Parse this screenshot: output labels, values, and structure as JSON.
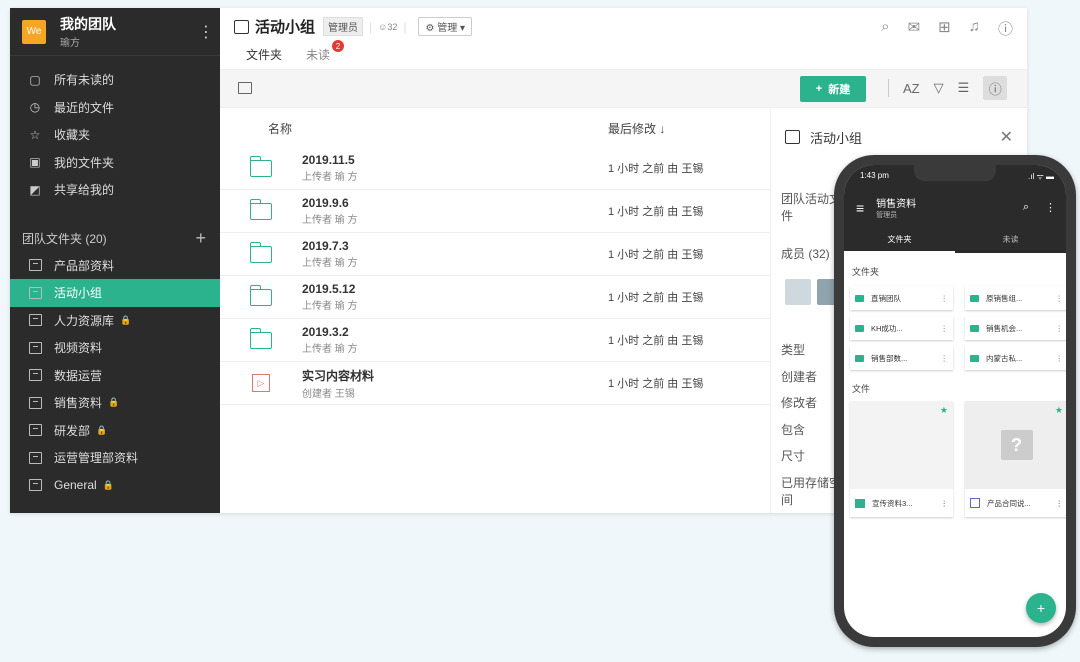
{
  "team": {
    "logo": "We",
    "name": "我的团队",
    "user": "瑜方"
  },
  "nav_top": [
    {
      "label": "所有未读的",
      "icon": "unread-icon"
    },
    {
      "label": "最近的文件",
      "icon": "clock-icon"
    },
    {
      "label": "收藏夹",
      "icon": "star-icon"
    },
    {
      "label": "我的文件夹",
      "icon": "my-folder-icon"
    },
    {
      "label": "共享给我的",
      "icon": "shared-icon"
    }
  ],
  "group": {
    "label": "团队文件夹 (20)",
    "add": "+"
  },
  "team_folders": [
    {
      "label": "产品部资料",
      "locked": false,
      "active": false
    },
    {
      "label": "活动小组",
      "locked": false,
      "active": true
    },
    {
      "label": "人力资源库",
      "locked": true,
      "active": false
    },
    {
      "label": "视频资料",
      "locked": false,
      "active": false
    },
    {
      "label": "数据运营",
      "locked": false,
      "active": false
    },
    {
      "label": "销售资料",
      "locked": true,
      "active": false
    },
    {
      "label": "研发部",
      "locked": true,
      "active": false
    },
    {
      "label": "运营管理部资料",
      "locked": false,
      "active": false
    },
    {
      "label": "General",
      "locked": true,
      "active": false
    }
  ],
  "header": {
    "title": "活动小组",
    "role": "管理员",
    "member_count": "32",
    "manage": "管理"
  },
  "tabs": [
    {
      "label": "文件夹",
      "active": true
    },
    {
      "label": "未读",
      "badge": "2"
    }
  ],
  "toolbar": {
    "new_label": "新建",
    "sort_label": "AZ"
  },
  "list": {
    "col_name": "名称",
    "col_modified": "最后修改 ↓",
    "rows": [
      {
        "type": "folder",
        "name": "2019.11.5",
        "sub": "上传者 瑜 方",
        "modified": "1 小时 之前 由 王锡"
      },
      {
        "type": "folder",
        "name": "2019.9.6",
        "sub": "上传者 瑜 方",
        "modified": "1 小时 之前 由 王锡"
      },
      {
        "type": "folder",
        "name": "2019.7.3",
        "sub": "上传者 瑜 方",
        "modified": "1 小时 之前 由 王锡"
      },
      {
        "type": "folder",
        "name": "2019.5.12",
        "sub": "上传者 瑜 方",
        "modified": "1 小时 之前 由 王锡"
      },
      {
        "type": "folder",
        "name": "2019.3.2",
        "sub": "上传者 瑜 方",
        "modified": "1 小时 之前 由 王锡"
      },
      {
        "type": "video",
        "name": "实习内容材料",
        "sub": "创建者 王锡",
        "modified": "1 小时 之前 由 王锡"
      }
    ]
  },
  "detail": {
    "title": "活动小组",
    "desc": "团队活动文件",
    "members": "成员 (32)",
    "props": [
      "类型",
      "创建者",
      "修改者",
      "包含",
      "尺寸",
      "已用存储空间"
    ]
  },
  "phone": {
    "time": "1:43 pm",
    "signal": ".ıl ᯤ ▬",
    "title": "销售资料",
    "subtitle": "管理员",
    "tab_folders": "文件夹",
    "tab_unread": "未读",
    "section_folders": "文件夹",
    "folders": [
      "直销团队",
      "原销售组...",
      "KH成功...",
      "销售机会...",
      "销售部数...",
      "内蒙古私..."
    ],
    "section_files": "文件",
    "files": [
      {
        "name": "宣传资料3...",
        "icon": "image-icon"
      },
      {
        "name": "产品合同说...",
        "icon": "document-icon",
        "placeholder": "?"
      }
    ],
    "fab": "+"
  },
  "colors": {
    "accent": "#2bb38e",
    "sidebar": "#2b2b2b",
    "badge": "#e53935"
  }
}
